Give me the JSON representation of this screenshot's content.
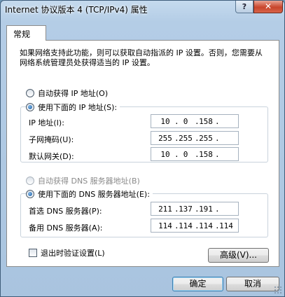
{
  "window": {
    "title": "Internet 协议版本 4 (TCP/IPv4) 属性",
    "help_label": "?",
    "close_label": "✕"
  },
  "tabs": [
    {
      "label": "常规"
    }
  ],
  "description": "如果网络支持此功能，则可以获取自动指派的 IP 设置。否则，您需要从网络系统管理员处获得适当的 IP 设置。",
  "ip_section": {
    "auto_label": "自动获得 IP 地址(O)",
    "manual_label": "使用下面的 IP 地址(S):",
    "selected": "manual",
    "fields": [
      {
        "label": "IP 地址(I):",
        "octets": [
          "10",
          "0",
          "158",
          ""
        ]
      },
      {
        "label": "子网掩码(U):",
        "octets": [
          "255",
          "255",
          "255",
          ""
        ]
      },
      {
        "label": "默认网关(D):",
        "octets": [
          "10",
          "0",
          "158",
          ""
        ]
      }
    ]
  },
  "dns_section": {
    "auto_label": "自动获得 DNS 服务器地址(B)",
    "manual_label": "使用下面的 DNS 服务器地址(E):",
    "selected": "manual",
    "fields": [
      {
        "label": "首选 DNS 服务器(P):",
        "octets": [
          "211",
          "137",
          "191",
          ""
        ]
      },
      {
        "label": "备用 DNS 服务器(A):",
        "octets": [
          "114",
          "114",
          "114",
          "114"
        ]
      }
    ]
  },
  "validate_on_exit": {
    "label": "退出时验证设置(L)",
    "checked": false
  },
  "advanced_button": "高级(V)...",
  "ok_button": "确定",
  "cancel_button": "取消"
}
